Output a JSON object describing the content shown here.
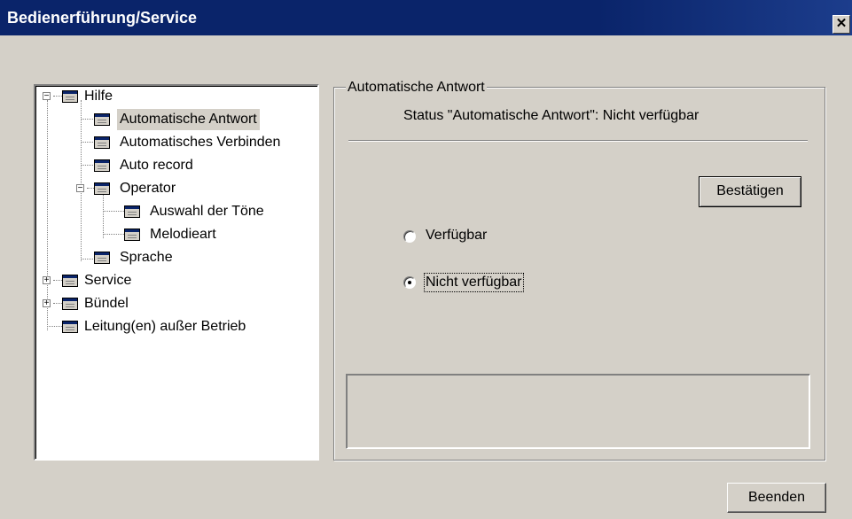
{
  "window": {
    "title": "Bedienerführung/Service",
    "close_label": "✕"
  },
  "tree": {
    "items": [
      {
        "label": "Hilfe",
        "expander": "−"
      },
      {
        "label": "Automatische Antwort",
        "selected": true
      },
      {
        "label": "Automatisches Verbinden"
      },
      {
        "label": "Auto record"
      },
      {
        "label": "Operator",
        "expander": "−"
      },
      {
        "label": "Auswahl der Töne"
      },
      {
        "label": "Melodieart"
      },
      {
        "label": "Sprache"
      },
      {
        "label": "Service",
        "expander": "+"
      },
      {
        "label": "Bündel",
        "expander": "+"
      },
      {
        "label": "Leitung(en) außer Betrieb"
      }
    ]
  },
  "panel": {
    "legend": "Automatische Antwort",
    "status": "Status \"Automatische Antwort\": Nicht verfügbar",
    "confirm_label": "Bestätigen",
    "options": [
      {
        "label": "Verfügbar",
        "checked": false
      },
      {
        "label": "Nicht verfügbar",
        "checked": true
      }
    ]
  },
  "footer": {
    "quit_label": "Beenden"
  },
  "colors": {
    "titlebar": "#0a246a",
    "face": "#d4d0c8"
  }
}
